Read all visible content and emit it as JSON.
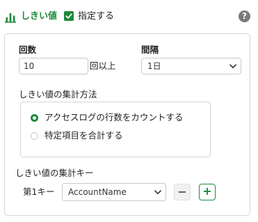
{
  "header": {
    "title": "しきい値",
    "title_icon": "bar-chart-icon",
    "enable_checkbox_checked": true,
    "enable_label": "指定する",
    "help_icon": "question-circle-icon",
    "help_glyph": "?"
  },
  "colors": {
    "accent": "#1f8a3c",
    "border": "#d6d6d6",
    "help_gray": "#7a7a7a"
  },
  "count": {
    "label": "回数",
    "value": "10",
    "suffix": "回以上"
  },
  "interval": {
    "label": "間隔",
    "selected": "1日"
  },
  "method": {
    "label": "しきい値の集計方法",
    "options": [
      {
        "label": "アクセスログの行数をカウントする",
        "selected": true
      },
      {
        "label": "特定項目を合計する",
        "selected": false
      }
    ]
  },
  "key": {
    "label": "しきい値の集計キー",
    "row_label": "第1キー",
    "selected": "AccountName",
    "minus_glyph": "−",
    "plus_glyph": "+"
  }
}
